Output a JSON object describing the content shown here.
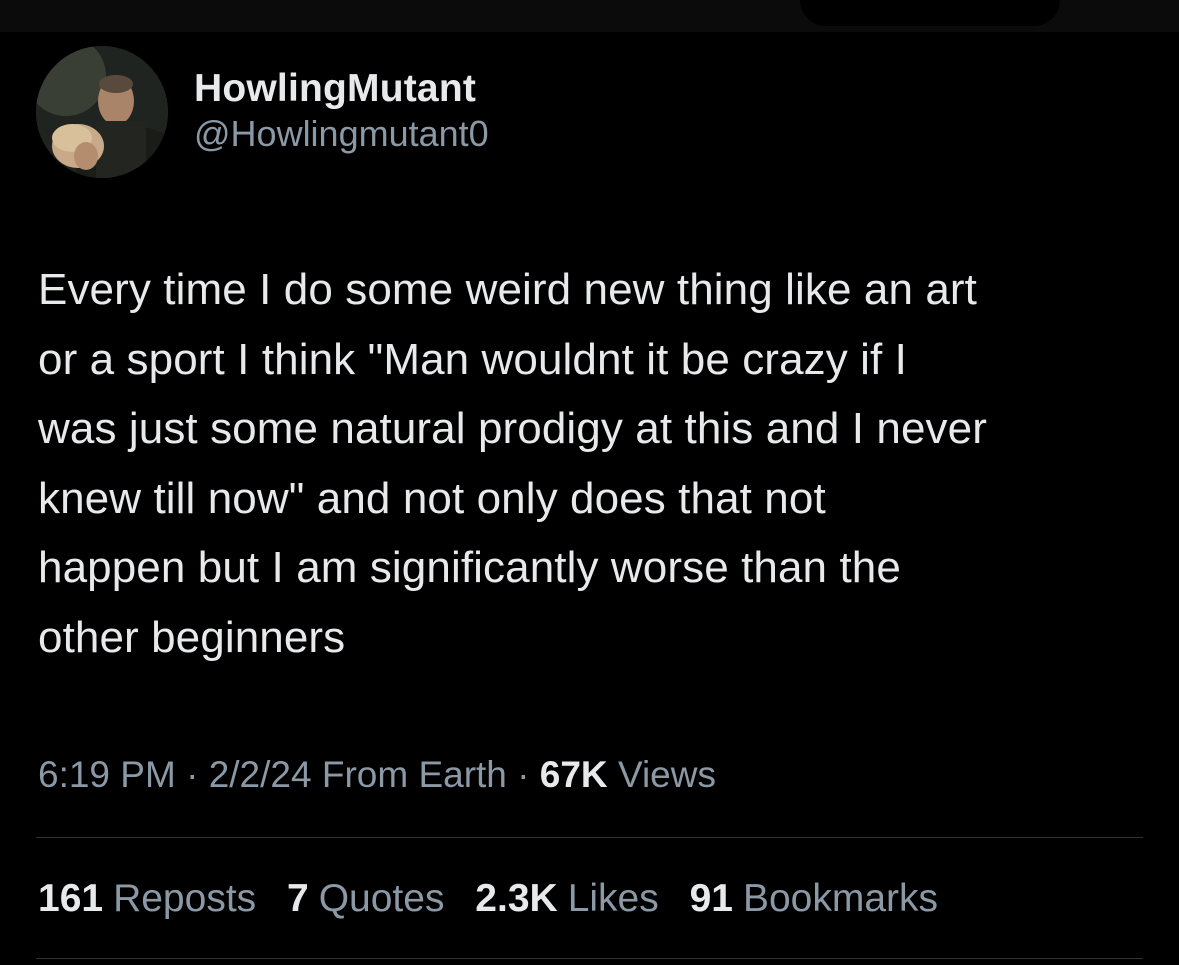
{
  "tweet": {
    "author": {
      "display_name": "HowlingMutant",
      "handle": "@Howlingmutant0",
      "avatar_icon": "user-avatar-photo"
    },
    "text": "Every time I do some weird new thing like an art\nor a sport I think \"Man wouldnt it be crazy if I\nwas just some natural prodigy at this and I never\nknew till now\" and not only does that not\nhappen but I am significantly worse than the\nother beginners",
    "meta": {
      "time": "6:19 PM",
      "separator": "·",
      "date": "2/2/24",
      "source": "From Earth",
      "views_count": "67K",
      "views_label": "Views"
    },
    "stats": {
      "reposts": {
        "count": "161",
        "label": "Reposts"
      },
      "quotes": {
        "count": "7",
        "label": "Quotes"
      },
      "likes": {
        "count": "2.3K",
        "label": "Likes"
      },
      "bookmarks": {
        "count": "91",
        "label": "Bookmarks"
      }
    }
  },
  "colors": {
    "background": "#000000",
    "primary_text": "#e7e9ea",
    "secondary_text": "#8b98a5",
    "divider": "#2f3336"
  }
}
